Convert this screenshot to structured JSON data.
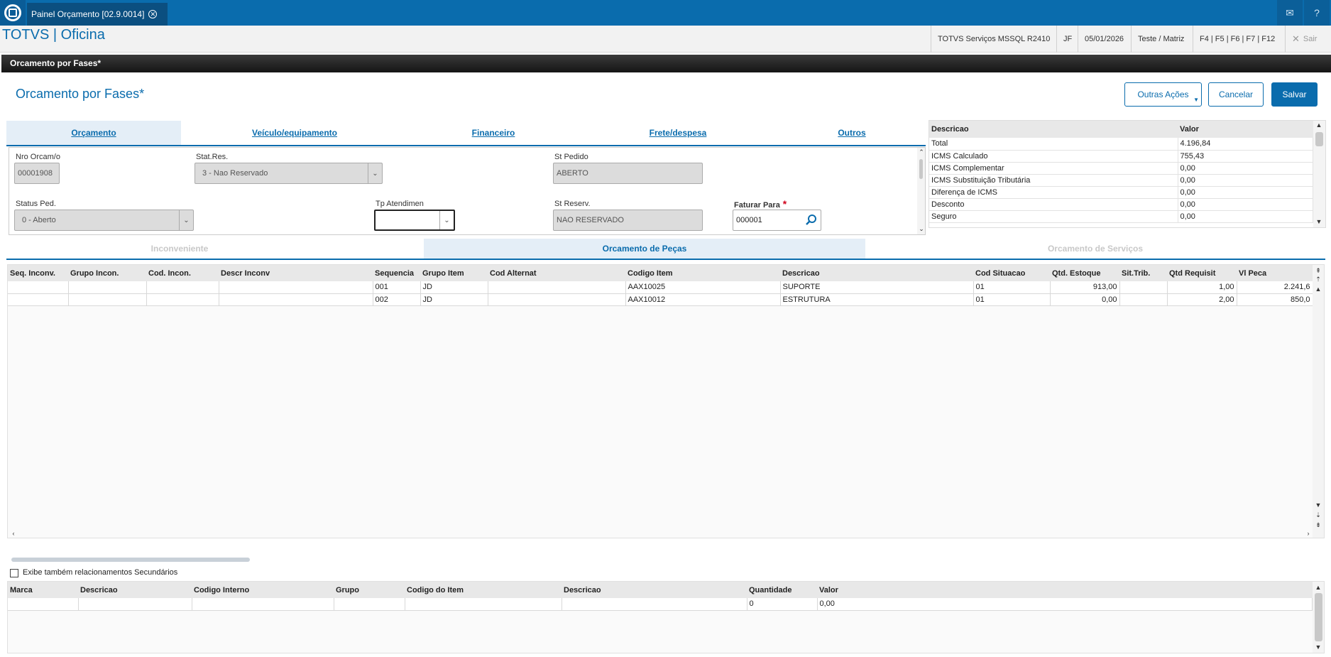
{
  "topbar": {
    "tab_label": "Painel Orçamento [02.9.0014]"
  },
  "brand": "TOTVS | Oficina",
  "status": {
    "environment": "TOTVS Serviços MSSQL R2410",
    "user": "JF",
    "date": "05/01/2026",
    "company": "Teste / Matriz",
    "shortcuts": "F4 | F5 | F6 | F7 | F12",
    "exit": "Sair"
  },
  "window_title": "Orcamento por Fases*",
  "page": {
    "title": "Orcamento por Fases*",
    "buttons": {
      "other_actions": "Outras Ações",
      "cancel": "Cancelar",
      "save": "Salvar"
    }
  },
  "folder_tabs": [
    "Orçamento",
    "Veículo/equipamento",
    "Financeiro",
    "Frete/despesa",
    "Outros"
  ],
  "form": {
    "nro_orcamento": {
      "label": "Nro Orcam/o",
      "value": "00001908"
    },
    "stat_res": {
      "label": "Stat.Res.",
      "value": "3 - Nao Reservado"
    },
    "st_pedido": {
      "label": "St Pedido",
      "value": "ABERTO"
    },
    "status_ped": {
      "label": "Status Ped.",
      "value": "0 - Aberto"
    },
    "tp_atendimen": {
      "label": "Tp Atendimen",
      "value": ""
    },
    "st_reserv": {
      "label": "St Reserv.",
      "value": "NAO RESERVADO"
    },
    "faturar_para": {
      "label": "Faturar Para",
      "value": "000001"
    }
  },
  "summary": {
    "headers": [
      "Descricao",
      "Valor"
    ],
    "rows": [
      [
        "Total",
        "4.196,84"
      ],
      [
        "ICMS Calculado",
        "755,43"
      ],
      [
        "ICMS Complementar",
        "0,00"
      ],
      [
        "ICMS Substituição Tributária",
        "0,00"
      ],
      [
        "Diferença de ICMS",
        "0,00"
      ],
      [
        "Desconto",
        "0,00"
      ],
      [
        "Seguro",
        "0,00"
      ]
    ]
  },
  "sub_tabs": [
    "Inconveniente",
    "Orcamento de Peças",
    "Orcamento de Serviços"
  ],
  "parts_grid": {
    "headers": [
      "Seq. Inconv.",
      "Grupo Incon.",
      "Cod. Incon.",
      "Descr Inconv",
      "Sequencia",
      "Grupo Item",
      "Cod Alternat",
      "Codigo Item",
      "Descricao",
      "Cod Situacao",
      "Qtd. Estoque",
      "Sit.Trib.",
      "Qtd Requisit",
      "Vl Peca"
    ],
    "rows": [
      [
        "",
        "",
        "",
        "",
        "001",
        "JD",
        "",
        "AAX10025",
        "SUPORTE",
        "01",
        "913,00",
        "",
        "1,00",
        "2.241,6"
      ],
      [
        "",
        "",
        "",
        "",
        "002",
        "JD",
        "",
        "AAX10012",
        "ESTRUTURA",
        "01",
        "0,00",
        "",
        "2,00",
        "850,0"
      ]
    ]
  },
  "secondary_checkbox_label": "Exibe também relacionamentos Secundários",
  "related_grid": {
    "headers": [
      "Marca",
      "Descricao",
      "Codigo Interno",
      "Grupo",
      "Codigo do Item",
      "Descricao",
      "Quantidade",
      "Valor"
    ],
    "rows": [
      [
        "",
        "",
        "",
        "",
        "",
        "",
        "0",
        "0,00"
      ]
    ]
  }
}
